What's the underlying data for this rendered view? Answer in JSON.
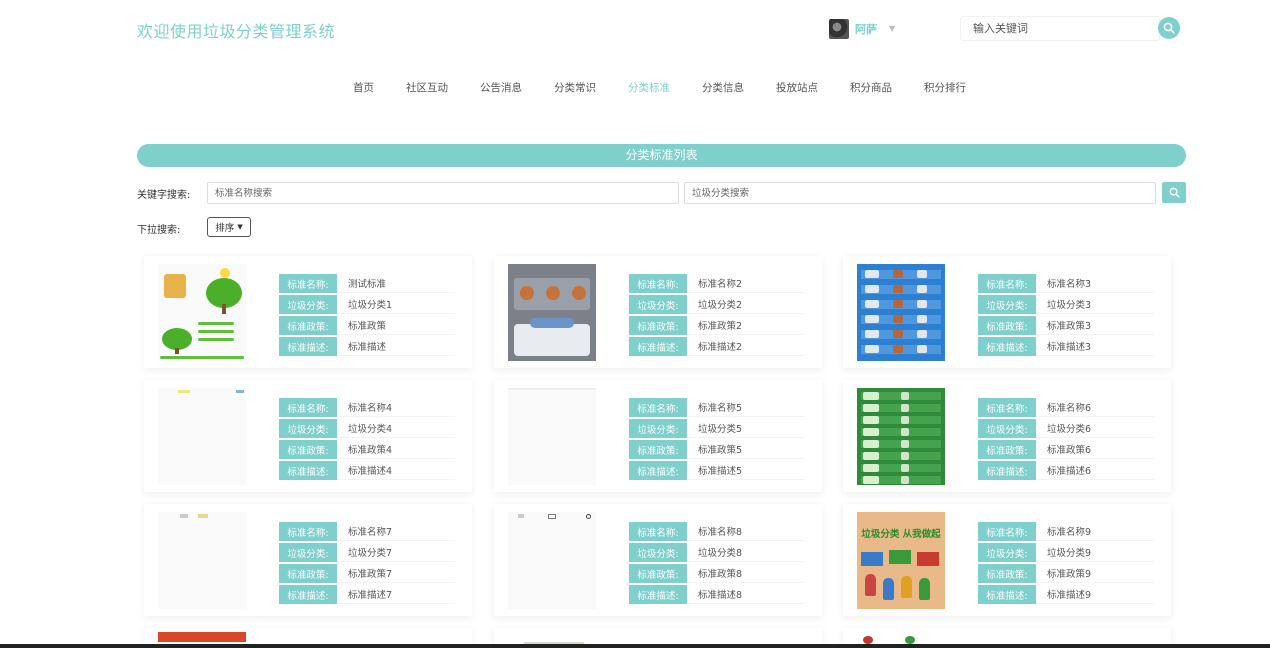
{
  "header": {
    "title": "欢迎使用垃圾分类管理系统",
    "user_name": "阿萨",
    "search_placeholder": "输入关键词"
  },
  "nav": {
    "items": [
      "首页",
      "社区互动",
      "公告消息",
      "分类常识",
      "分类标准",
      "分类信息",
      "投放站点",
      "积分商品",
      "积分排行"
    ],
    "active": "分类标准"
  },
  "list": {
    "banner_title": "分类标准列表",
    "keyword_label": "关键字搜索:",
    "name_placeholder": "标准名称搜索",
    "category_placeholder": "垃圾分类搜索",
    "dropdown_label": "下拉搜索:",
    "sort_label": "排序"
  },
  "field_labels": {
    "name": "标准名称:",
    "category": "垃圾分类:",
    "policy": "标准政策:",
    "desc": "标准描述:"
  },
  "cards": [
    {
      "name": "测试标准",
      "category": "垃圾分类1",
      "policy": "标准政策",
      "desc": "标准描述",
      "image": "trees-illustration"
    },
    {
      "name": "标准名称2",
      "category": "垃圾分类2",
      "policy": "标准政策2",
      "desc": "标准描述2",
      "image": "gray-waste-poster"
    },
    {
      "name": "标准名称3",
      "category": "垃圾分类3",
      "policy": "标准政策3",
      "desc": "标准描述3",
      "image": "blue-sorting-chart"
    },
    {
      "name": "标准名称4",
      "category": "垃圾分类4",
      "policy": "标准政策4",
      "desc": "标准描述4",
      "image": "blank-image"
    },
    {
      "name": "标准名称5",
      "category": "垃圾分类5",
      "policy": "标准政策5",
      "desc": "标准描述5",
      "image": "blank-image"
    },
    {
      "name": "标准名称6",
      "category": "垃圾分类6",
      "policy": "标准政策6",
      "desc": "标准描述6",
      "image": "green-sorting-chart"
    },
    {
      "name": "标准名称7",
      "category": "垃圾分类7",
      "policy": "标准政策7",
      "desc": "标准描述7",
      "image": "blank-image"
    },
    {
      "name": "标准名称8",
      "category": "垃圾分类8",
      "policy": "标准政策8",
      "desc": "标准描述8",
      "image": "blank-image"
    },
    {
      "name": "标准名称9",
      "category": "垃圾分类9",
      "policy": "标准政策9",
      "desc": "标准描述9",
      "image": "kids-poster"
    }
  ],
  "poster_text": "垃圾分类  从我做起",
  "colors": {
    "accent": "#7fd0cc",
    "text": "#555555"
  }
}
